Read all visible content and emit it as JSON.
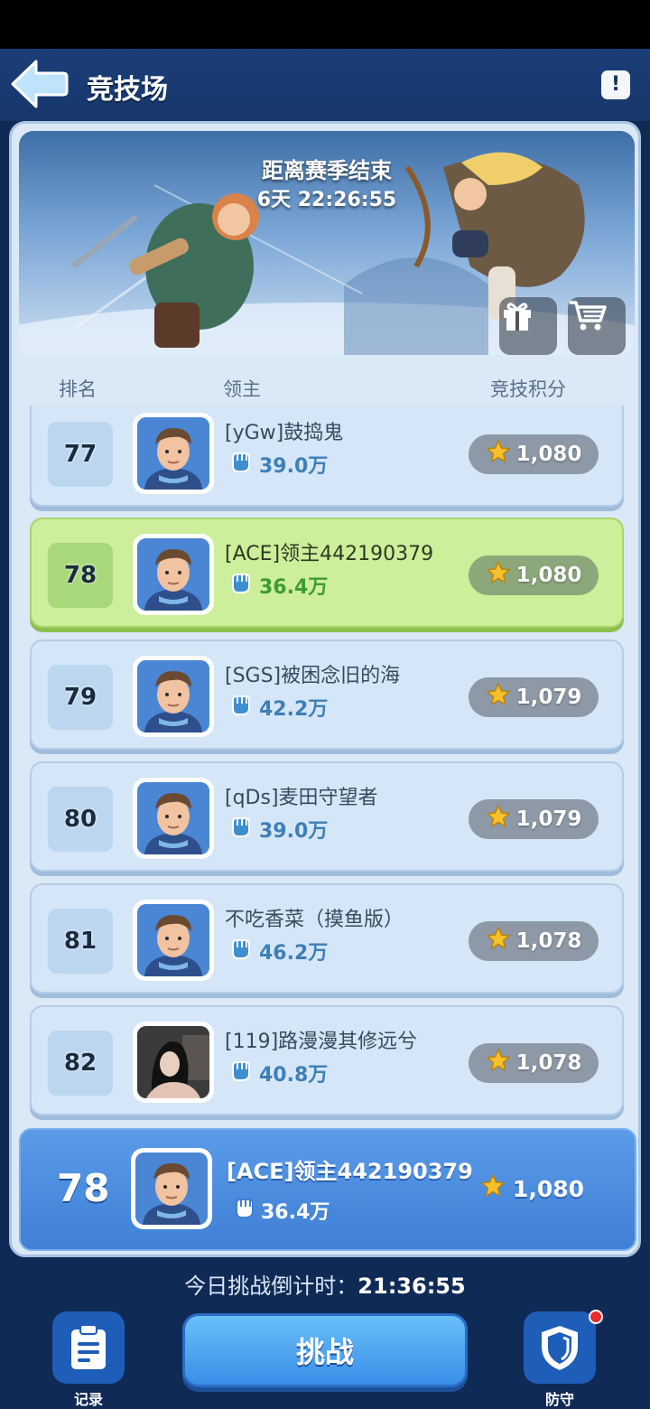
{
  "header": {
    "title": "竞技场",
    "info_label": "!"
  },
  "banner": {
    "season_label": "距离赛季结束",
    "season_timer": "6天 22:26:55",
    "buttons": [
      "gift-icon",
      "shop-cart-icon"
    ]
  },
  "columns": {
    "rank": "排名",
    "lord": "领主",
    "score": "竞技积分"
  },
  "rows": [
    {
      "rank": "77",
      "name": "[yGw]鼓捣鬼",
      "power": "39.0万",
      "score": "1,080",
      "highlight": false
    },
    {
      "rank": "78",
      "name": "[ACE]领主442190379",
      "power": "36.4万",
      "score": "1,080",
      "highlight": true
    },
    {
      "rank": "79",
      "name": "[SGS]被困念旧的海",
      "power": "42.2万",
      "score": "1,079",
      "highlight": false
    },
    {
      "rank": "80",
      "name": "[qDs]麦田守望者",
      "power": "39.0万",
      "score": "1,079",
      "highlight": false
    },
    {
      "rank": "81",
      "name": "不吃香菜（摸鱼版）",
      "power": "46.2万",
      "score": "1,078",
      "highlight": false
    },
    {
      "rank": "82",
      "name": "[119]路漫漫其修远兮",
      "power": "40.8万",
      "score": "1,078",
      "highlight": false
    }
  ],
  "my_entry": {
    "rank": "78",
    "name": "[ACE]领主442190379",
    "power": "36.4万",
    "score": "1,080"
  },
  "footer": {
    "countdown_label": "今日挑战倒计时：",
    "countdown_value": "21:36:55",
    "records_label": "记录",
    "challenge_label": "挑战",
    "defense_label": "防守"
  },
  "colors": {
    "highlight_row": "#cdee9a",
    "my_card": "#4a8ce0",
    "star": "#f5c02a",
    "notify": "#e82a2a"
  }
}
